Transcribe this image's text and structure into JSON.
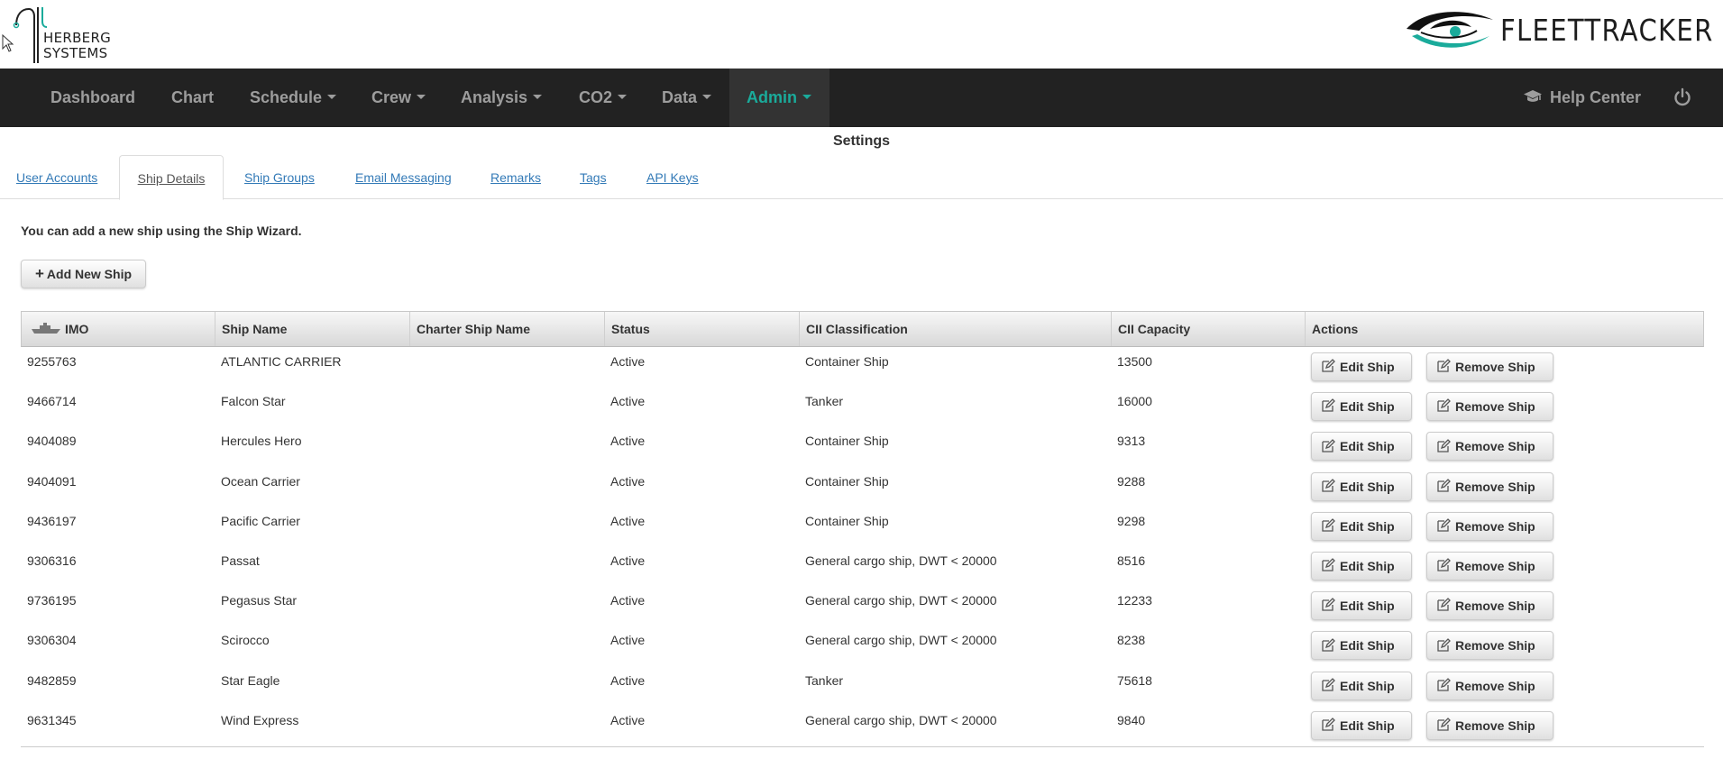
{
  "header": {
    "company_logo_text": "HERBERG\nSYSTEMS",
    "company_line1": "HERBERG",
    "company_line2": "SYSTEMS",
    "brand_text": "FLEETTRACKER"
  },
  "nav": {
    "items": [
      {
        "label": "Dashboard",
        "dropdown": false
      },
      {
        "label": "Chart",
        "dropdown": false
      },
      {
        "label": "Schedule",
        "dropdown": true
      },
      {
        "label": "Crew",
        "dropdown": true
      },
      {
        "label": "Analysis",
        "dropdown": true
      },
      {
        "label": "CO2",
        "dropdown": true
      },
      {
        "label": "Data",
        "dropdown": true
      },
      {
        "label": "Admin",
        "dropdown": true,
        "active": true
      }
    ],
    "help_label": "Help Center",
    "accent_color": "#1aab9b"
  },
  "page": {
    "title": "Settings"
  },
  "tabs": [
    {
      "label": "User Accounts"
    },
    {
      "label": "Ship Details",
      "active": true
    },
    {
      "label": "Ship Groups"
    },
    {
      "label": "Email Messaging"
    },
    {
      "label": "Remarks"
    },
    {
      "label": "Tags"
    },
    {
      "label": "API Keys"
    }
  ],
  "intro": {
    "text": "You can add a new ship using the Ship Wizard.",
    "add_button_label": "Add New Ship"
  },
  "table": {
    "columns": [
      "IMO",
      "Ship Name",
      "Charter Ship Name",
      "Status",
      "CII Classification",
      "CII Capacity",
      "Actions"
    ],
    "edit_label": "Edit Ship",
    "remove_label": "Remove Ship",
    "rows": [
      {
        "imo": "9255763",
        "name": "ATLANTIC CARRIER",
        "charter": "",
        "status": "Active",
        "cii_class": "Container Ship",
        "cii_capacity": "13500"
      },
      {
        "imo": "9466714",
        "name": "Falcon Star",
        "charter": "",
        "status": "Active",
        "cii_class": "Tanker",
        "cii_capacity": "16000"
      },
      {
        "imo": "9404089",
        "name": "Hercules Hero",
        "charter": "",
        "status": "Active",
        "cii_class": "Container Ship",
        "cii_capacity": "9313"
      },
      {
        "imo": "9404091",
        "name": "Ocean Carrier",
        "charter": "",
        "status": "Active",
        "cii_class": "Container Ship",
        "cii_capacity": "9288"
      },
      {
        "imo": "9436197",
        "name": "Pacific Carrier",
        "charter": "",
        "status": "Active",
        "cii_class": "Container Ship",
        "cii_capacity": "9298"
      },
      {
        "imo": "9306316",
        "name": "Passat",
        "charter": "",
        "status": "Active",
        "cii_class": "General cargo ship, DWT < 20000",
        "cii_capacity": "8516"
      },
      {
        "imo": "9736195",
        "name": "Pegasus Star",
        "charter": "",
        "status": "Active",
        "cii_class": "General cargo ship, DWT < 20000",
        "cii_capacity": "12233"
      },
      {
        "imo": "9306304",
        "name": "Scirocco",
        "charter": "",
        "status": "Active",
        "cii_class": "General cargo ship, DWT < 20000",
        "cii_capacity": "8238"
      },
      {
        "imo": "9482859",
        "name": "Star Eagle",
        "charter": "",
        "status": "Active",
        "cii_class": "Tanker",
        "cii_capacity": "75618"
      },
      {
        "imo": "9631345",
        "name": "Wind Express",
        "charter": "",
        "status": "Active",
        "cii_class": "General cargo ship, DWT < 20000",
        "cii_capacity": "9840"
      }
    ]
  }
}
